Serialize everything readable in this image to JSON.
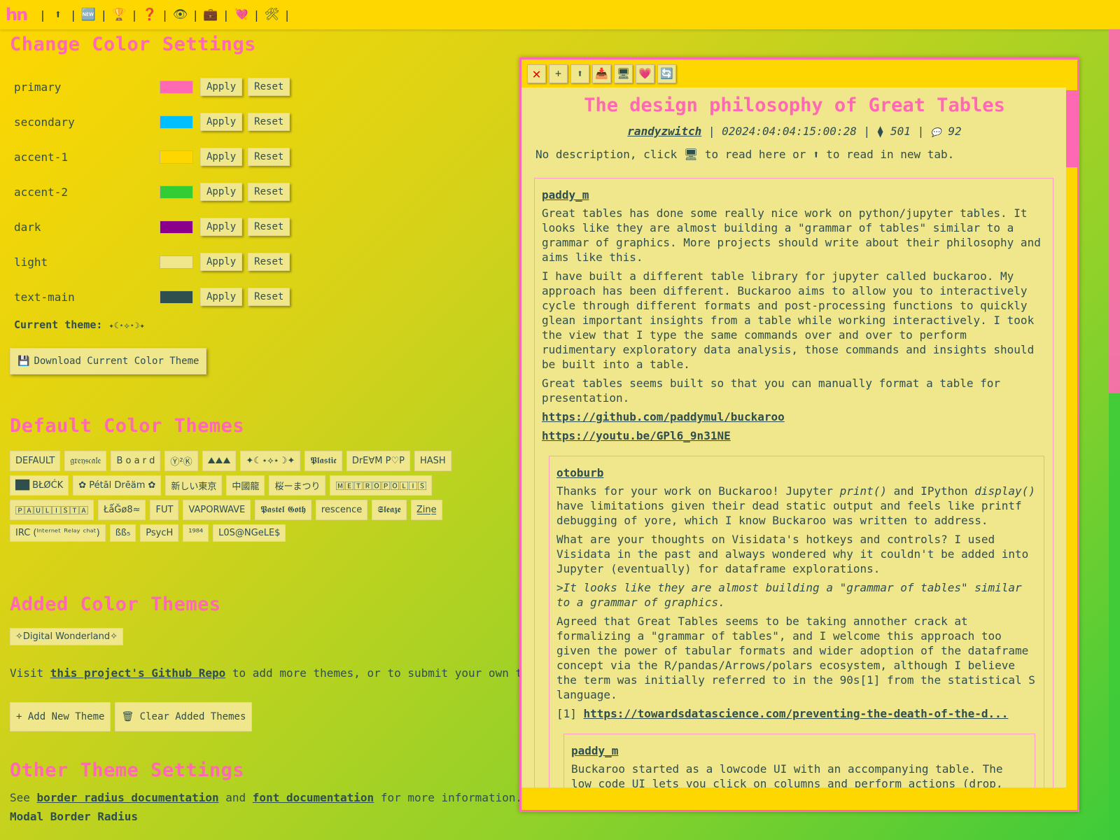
{
  "nav": {
    "logo": "hn",
    "icons": [
      {
        "name": "top-icon",
        "glyph": "⬆"
      },
      {
        "name": "new-icon",
        "glyph": "🆕"
      },
      {
        "name": "trophy-icon",
        "glyph": "🏆"
      },
      {
        "name": "question-icon",
        "glyph": "❓"
      },
      {
        "name": "eye-icon",
        "glyph": "👁"
      },
      {
        "name": "briefcase-icon",
        "glyph": "💼"
      },
      {
        "name": "heart-arrow-icon",
        "glyph": "💘"
      },
      {
        "name": "tools-icon",
        "glyph": "🛠"
      }
    ],
    "separator": "|"
  },
  "settings": {
    "title": "Change Color Settings",
    "apply_label": "Apply",
    "reset_label": "Reset",
    "colors": [
      {
        "name": "primary",
        "value": "#ff69b4"
      },
      {
        "name": "secondary",
        "value": "#00bfff"
      },
      {
        "name": "accent-1",
        "value": "#ffd700"
      },
      {
        "name": "accent-2",
        "value": "#32cd32"
      },
      {
        "name": "dark",
        "value": "#8b008b"
      },
      {
        "name": "light",
        "value": "#f0e68c"
      },
      {
        "name": "text-main",
        "value": "#2f4f4f"
      }
    ],
    "current_theme_label": "Current theme:",
    "current_theme_value": "✦☾⋆⟡⋆☽✦",
    "download_icon": "💾",
    "download_label": "Download Current Color Theme"
  },
  "default_themes": {
    "title": "Default Color Themes",
    "items": [
      "DEFAULT",
      "𝔤𝔯𝔢𝔶𝔰𝔠𝔞𝔩𝔢",
      "B o a r d",
      "Ⓨ²Ⓚ",
      "⛰⛰⛰",
      "✦☾⋆⟡⋆☽✦",
      "𝕻𝖑𝖆𝖘𝖙𝖎𝖈",
      "DrE∀M P♡P",
      "HASH",
      "██ BŁØĆK",
      "✿ Pétāl Drēäm ✿",
      "新しい東京",
      "中國龍",
      "桜ーまつり",
      "🄼🄴🅃🅁🄾🄿🄾🄻🄸🅂",
      "🄿🄰🅄🄻🄸🅂🅃🄰",
      "ŁǻĞø8≈",
      "FUT",
      "VAPORWAVE",
      "𝕻𝖆𝖘𝖙𝖊𝖑 𝕲𝖔𝖙𝖍",
      "rescence",
      "𝕾𝖑𝖊𝖆𝖟𝖊",
      "Z̲i̲n̲e̲",
      "IRC (ᴵⁿᵗᵉʳⁿᵉᵗ ᴿᵉˡᵃʸ ᶜʰᵃᵗ)",
      "ßß₅",
      "PsycH",
      "¹⁹⁸⁴",
      "L0S@NGeLE$"
    ]
  },
  "added_themes": {
    "title": "Added Color Themes",
    "items": [
      "✧Digital Wonderland✧"
    ]
  },
  "visit": {
    "prefix": "Visit ",
    "link": "this project's Github Repo",
    "suffix": " to add more themes, or to submit your own t"
  },
  "actions": {
    "add_label": "+ Add New Theme",
    "clear_icon": "🗑",
    "clear_label": "Clear Added Themes"
  },
  "other": {
    "title": "Other Theme Settings",
    "see": "See ",
    "link1": "border radius documentation",
    "and": " and ",
    "link2": "font documentation",
    "suffix": " for more information.",
    "radius_label": "Modal Border Radius"
  },
  "modal": {
    "toolbar": [
      {
        "name": "close-icon",
        "glyph": "✕"
      },
      {
        "name": "plus-icon",
        "glyph": "+"
      },
      {
        "name": "open-new-tab-icon",
        "glyph": "⬆"
      },
      {
        "name": "inbox-icon",
        "glyph": "📥"
      },
      {
        "name": "monitor-icon",
        "glyph": "🖥"
      },
      {
        "name": "heart-icon",
        "glyph": "💗"
      },
      {
        "name": "refresh-icon",
        "glyph": "🔄"
      }
    ],
    "story": {
      "title": "The design philosophy of Great Tables",
      "author": "randyzwitch",
      "timestamp": "02024:04:04:15:00:28",
      "points_icon": "⧫",
      "points": "501",
      "comments_icon": "💬",
      "comments": "92",
      "desc_a": "No description, click ",
      "desc_b": " to read here or ",
      "desc_c": " to read in new tab."
    },
    "comments": [
      {
        "user": "paddy_m",
        "paragraphs": [
          "Great tables has done some really nice work on python/jupyter tables. It looks like they are almost building a \"grammar of tables\" similar to a grammar of graphics. More projects should write about their philosophy and aims like this.",
          "I have built a different table library for jupyter called buckaroo. My approach has been different. Buckaroo aims to allow you to interactively cycle through different formats and post-processing functions to quickly glean important insights from a table while working interactively. I took the view that I type the same commands over and over to perform rudimentary exploratory data analysis, those commands and insights should be built into a table.",
          "Great tables seems built so that you can manually format a table for presentation."
        ],
        "links": [
          "https://github.com/paddymul/buckaroo",
          "https://youtu.be/GPl6_9n31NE"
        ]
      },
      {
        "user": "otoburb",
        "p1_a": "Thanks for your work on Buckaroo! Jupyter ",
        "p1_em1": "print()",
        "p1_b": " and IPython ",
        "p1_em2": "display()",
        "p1_c": " have limitations given their dead static output and feels like printf debugging of yore, which I know Buckaroo was written to address.",
        "p2": "What are your thoughts on Visidata's hotkeys and controls? I used Visidata in the past and always wondered why it couldn't be added into Jupyter (eventually) for dataframe explorations.",
        "quote": ">It looks like they are almost building a \"grammar of tables\" similar to a grammar of graphics.",
        "p3": "Agreed that Great Tables seems to be taking annother crack at formalizing a \"grammar of tables\", and I welcome this approach too given the power of tabular formats and wider adoption of the dataframe concept via the R/pandas/Arrows/polars ecosystem, although I believe the term was initially referred to in the 90s[1] from the statistical S language.",
        "ref": "[1] ",
        "ref_link": "https://towardsdatascience.com/preventing-the-death-of-the-d..."
      },
      {
        "user": "paddy_m",
        "p1": "Buckaroo started as a lowcode UI with an accompanying table. The low code UI lets you click on columns and perform actions (drop,"
      }
    ]
  }
}
